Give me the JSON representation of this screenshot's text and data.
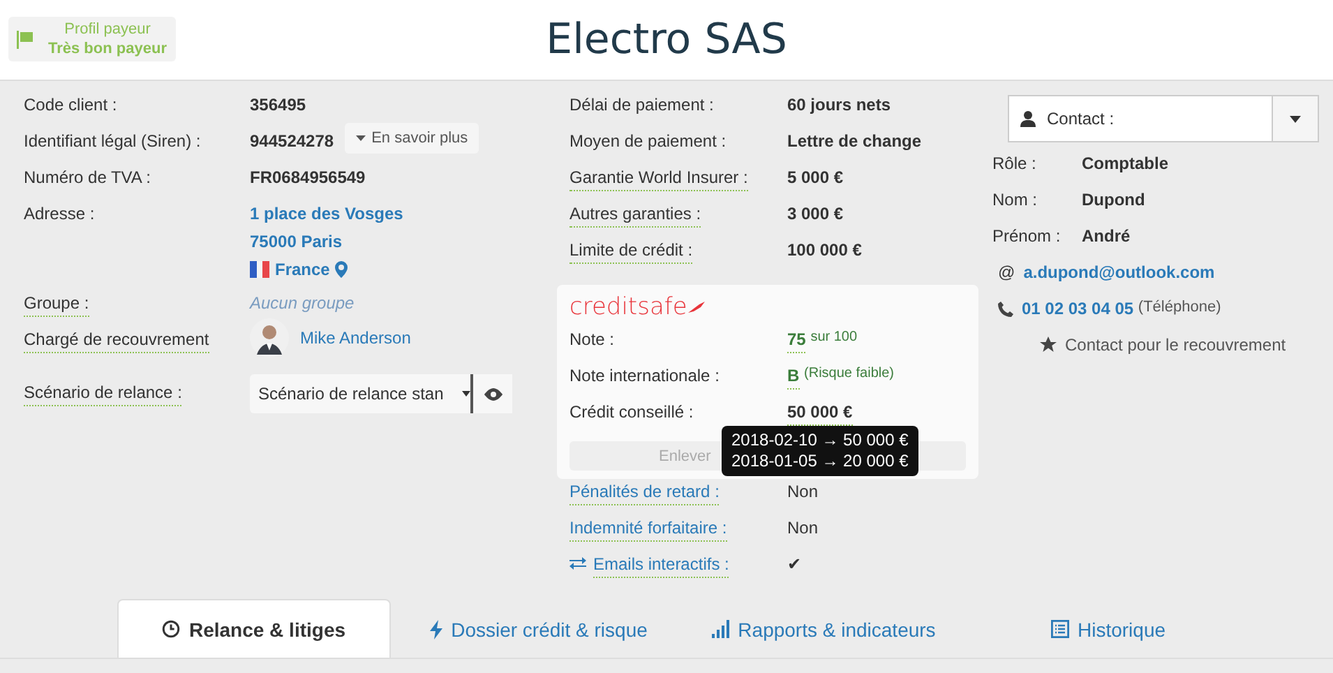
{
  "payer_profile": {
    "label": "Profil payeur",
    "value": "Très bon payeur"
  },
  "title": "Electro SAS",
  "left_rows": [
    {
      "kind": "text",
      "label": "Code client :",
      "underlined": false,
      "value": "356495"
    },
    {
      "kind": "siren",
      "label": "Identifiant légal (Siren) :",
      "underlined": false,
      "value": "944524278",
      "button": "En savoir plus"
    },
    {
      "kind": "text",
      "label": "Numéro de TVA :",
      "underlined": false,
      "value": "FR0684956549"
    },
    {
      "kind": "address",
      "label": "Adresse :",
      "underlined": false,
      "lines": [
        "1 place des Vosges",
        "75000 Paris"
      ],
      "country": "France"
    },
    {
      "kind": "muted",
      "label": "Groupe :",
      "underlined": true,
      "value": "Aucun groupe"
    },
    {
      "kind": "person",
      "label": "Chargé de recouvrement",
      "underlined": true,
      "value": "Mike Anderson"
    },
    {
      "kind": "select",
      "label": "Scénario de relance :",
      "underlined": true,
      "value": "Scénario de relance stan"
    }
  ],
  "middle_rows": [
    {
      "label": "Délai de paiement :",
      "underlined": false,
      "value": "60 jours nets"
    },
    {
      "label": "Moyen de paiement :",
      "underlined": false,
      "value": "Lettre de change"
    },
    {
      "label": "Garantie World Insurer :",
      "underlined": true,
      "value": "5 000 €"
    },
    {
      "label": "Autres garanties :",
      "underlined": true,
      "value": "3 000 €"
    },
    {
      "label": "Limite de crédit :",
      "underlined": true,
      "value": "100 000 €"
    }
  ],
  "creditsafe": {
    "logo": "creditsafe",
    "rows": [
      {
        "kind": "score",
        "label": "Note :",
        "value": "75",
        "note": "sur 100"
      },
      {
        "kind": "score",
        "label": "Note internationale :",
        "value": "B",
        "note": "(Risque faible)"
      },
      {
        "kind": "amount",
        "label": "Crédit conseillé :",
        "value": "50 000 €"
      }
    ],
    "button": "Enlever",
    "tooltip": [
      "2018-02-10 → 50 000 €",
      "2018-01-05 → 20 000 €"
    ]
  },
  "link_rows": [
    {
      "kind": "plain",
      "label": "Pénalités de retard :",
      "value": "Non"
    },
    {
      "kind": "plain",
      "label": "Indemnité forfaitaire :",
      "value": "Non"
    },
    {
      "kind": "swap",
      "label": "Emails interactifs :",
      "value": "✔"
    }
  ],
  "contact": {
    "select": "Contact :",
    "fields": [
      {
        "label": "Rôle :",
        "value": "Comptable"
      },
      {
        "label": "Nom :",
        "value": "Dupond"
      },
      {
        "label": "Prénom :",
        "value": "André"
      }
    ],
    "at": "@",
    "email": "a.dupond@outlook.com",
    "phone": "01 02 03 04 05",
    "phone_note": "(Téléphone)",
    "recovery": "Contact pour le recouvrement"
  },
  "tabs": [
    {
      "label": "Relance & litiges",
      "kind": "clock",
      "selected": true
    },
    {
      "label": "Dossier crédit & risque",
      "kind": "bolt",
      "selected": false
    },
    {
      "label": "Rapports & indicateurs",
      "kind": "bars",
      "selected": false
    },
    {
      "label": "Historique",
      "kind": "list",
      "selected": false
    }
  ]
}
